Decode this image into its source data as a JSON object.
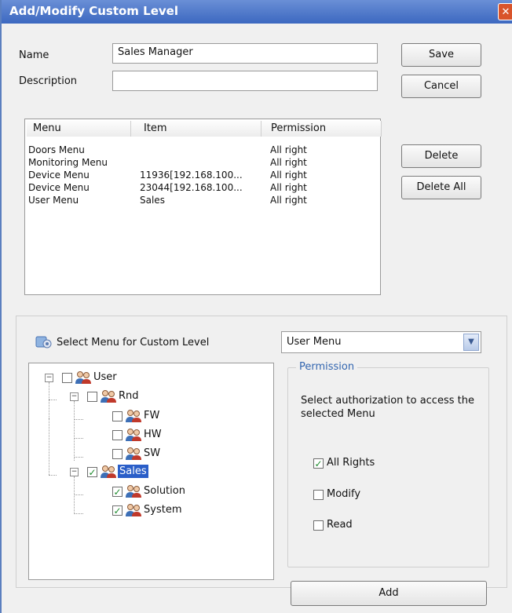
{
  "window": {
    "title": "Add/Modify Custom Level",
    "close_glyph": "✕"
  },
  "form": {
    "name_label": "Name",
    "name_value": "Sales Manager",
    "description_label": "Description",
    "description_value": ""
  },
  "buttons": {
    "save": "Save",
    "cancel": "Cancel",
    "delete": "Delete",
    "delete_all": "Delete All",
    "add": "Add"
  },
  "list": {
    "columns": [
      "Menu",
      "Item",
      "Permission"
    ],
    "rows": [
      {
        "menu": "Doors Menu",
        "item": "",
        "permission": "All right"
      },
      {
        "menu": "Monitoring Menu",
        "item": "",
        "permission": "All right"
      },
      {
        "menu": "Device Menu",
        "item": "11936[192.168.100...",
        "permission": "All right"
      },
      {
        "menu": "Device Menu",
        "item": "23044[192.168.100...",
        "permission": "All right"
      },
      {
        "menu": "User Menu",
        "item": "Sales",
        "permission": "All right"
      }
    ]
  },
  "select_menu": {
    "label": "Select Menu for Custom Level",
    "icon": "menu-gear-icon",
    "selected": "User Menu"
  },
  "tree": {
    "nodes": [
      {
        "label": "User",
        "checked": false
      },
      {
        "label": "Rnd",
        "checked": false
      },
      {
        "label": "FW",
        "checked": false
      },
      {
        "label": "HW",
        "checked": false
      },
      {
        "label": "SW",
        "checked": false
      },
      {
        "label": "Sales",
        "checked": true,
        "selected": true
      },
      {
        "label": "Solution",
        "checked": true
      },
      {
        "label": "System",
        "checked": true
      }
    ]
  },
  "permission": {
    "title": "Permission",
    "description": "Select authorization to access the selected Menu",
    "options": [
      {
        "label": "All Rights",
        "checked": true
      },
      {
        "label": "Modify",
        "checked": false
      },
      {
        "label": "Read",
        "checked": false
      }
    ]
  },
  "colors": {
    "title_bar": "#3c68c0",
    "selection": "#2a5ec8",
    "check": "#1c8a2c",
    "close": "#d9542b"
  }
}
